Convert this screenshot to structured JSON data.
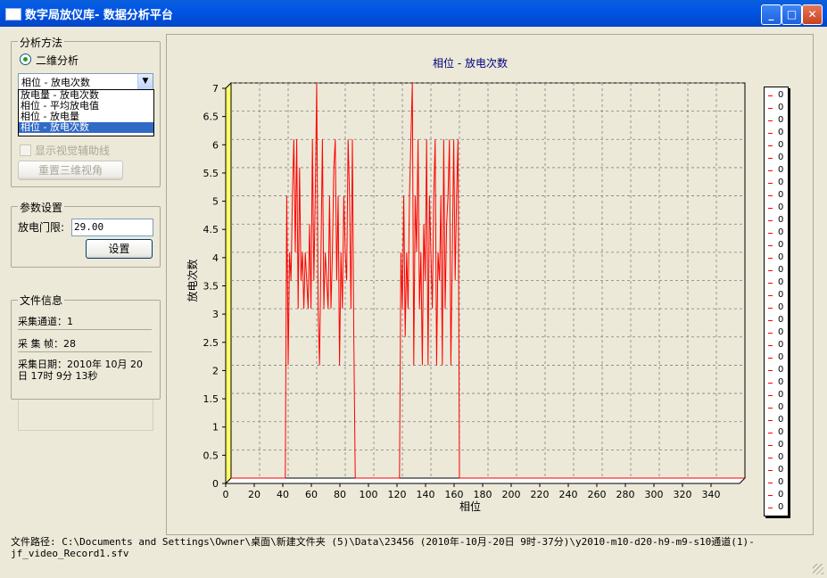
{
  "window": {
    "title": "数字局放仪库- 数据分析平台",
    "buttons": [
      "_",
      "□",
      "✕"
    ]
  },
  "analysis": {
    "group_title": "分析方法",
    "radio_label": "二维分析",
    "combo_value": "相位 - 放电次数",
    "dropdown_items": [
      "放电量 - 放电次数",
      "相位 - 平均放电值",
      "相位 - 放电量",
      "相位 - 放电次数"
    ],
    "checkbox_label": "显示视觉辅助线",
    "reset_button": "重置三维视角"
  },
  "params": {
    "group_title": "参数设置",
    "threshold_label": "放电门限:",
    "threshold_value": "29.00",
    "set_button": "设置"
  },
  "fileinfo": {
    "group_title": "文件信息",
    "channel": "采集通道：1",
    "frames": "采 集 帧：28",
    "date": "采集日期：2010年 10月 20日 17时 9分 13秒"
  },
  "chart_data": {
    "type": "line",
    "title": "相位 - 放电次数",
    "xlabel": "相位",
    "ylabel": "放电次数",
    "xlim": [
      0,
      360
    ],
    "ylim": [
      0,
      7
    ],
    "xticks": [
      0,
      20,
      40,
      60,
      80,
      100,
      120,
      140,
      160,
      180,
      200,
      220,
      240,
      260,
      280,
      300,
      320,
      340
    ],
    "yticks": [
      0,
      0.5,
      1,
      1.5,
      2,
      2.5,
      3,
      3.5,
      4,
      4.5,
      5,
      5.5,
      6,
      6.5,
      7
    ],
    "series_color": "#ff0000",
    "grid": true,
    "legend_values": [
      "0",
      "0",
      "0",
      "0",
      "0",
      "0",
      "0",
      "0",
      "0",
      "0",
      "0",
      "0",
      "0",
      "0",
      "0",
      "0",
      "0",
      "0",
      "0",
      "0",
      "0",
      "0",
      "0",
      "0",
      "0",
      "0",
      "0",
      "0",
      "0",
      "0",
      "0",
      "0",
      "0",
      "0"
    ],
    "series": [
      {
        "x": [
          0,
          38,
          39,
          40,
          41,
          42,
          43,
          44,
          45,
          46,
          47,
          48,
          49,
          50,
          51,
          52,
          53,
          54,
          55,
          56,
          57,
          58,
          59,
          60,
          61,
          62,
          63,
          64,
          65,
          66,
          67,
          68,
          69,
          70,
          71,
          72,
          73,
          74,
          75,
          76,
          77,
          78,
          79,
          80,
          81,
          82,
          83,
          84,
          85,
          86,
          87,
          88,
          117,
          118,
          119,
          120,
          121,
          122,
          123,
          124,
          125,
          126,
          127,
          128,
          129,
          130,
          131,
          132,
          133,
          134,
          135,
          136,
          137,
          138,
          139,
          140,
          141,
          142,
          143,
          144,
          145,
          146,
          147,
          148,
          149,
          150,
          151,
          152,
          153,
          154,
          155,
          156,
          157,
          158,
          159,
          160,
          360
        ],
        "y": [
          0,
          0,
          5,
          2,
          4,
          3.5,
          5,
          6,
          4,
          6,
          3,
          5.5,
          3.5,
          4,
          3,
          4,
          3.5,
          3,
          4.5,
          3,
          6,
          3.5,
          5,
          7,
          3,
          2,
          4,
          6,
          3,
          4,
          3.5,
          3,
          5,
          3,
          4,
          5.5,
          6,
          3.5,
          5,
          2,
          4,
          3,
          5,
          4,
          3.5,
          6,
          5,
          3,
          6,
          2.5,
          0,
          0,
          0,
          0,
          4,
          3,
          5,
          2.5,
          4,
          3,
          5,
          6,
          7,
          2,
          5,
          4,
          6,
          3,
          4,
          2,
          4.5,
          3.5,
          6,
          2,
          5,
          4,
          3,
          5,
          6,
          2,
          4,
          3.5,
          5,
          2,
          6,
          3,
          4.5,
          5,
          6,
          2,
          4,
          6,
          3.5,
          5,
          6,
          0,
          0
        ]
      }
    ]
  },
  "status": {
    "path": "文件路径:  C:\\Documents and Settings\\Owner\\桌面\\新建文件夹 (5)\\Data\\23456 (2010年-10月-20日 9时-37分)\\y2010-m10-d20-h9-m9-s10通道(1)-jf_video_Record1.sfv"
  }
}
